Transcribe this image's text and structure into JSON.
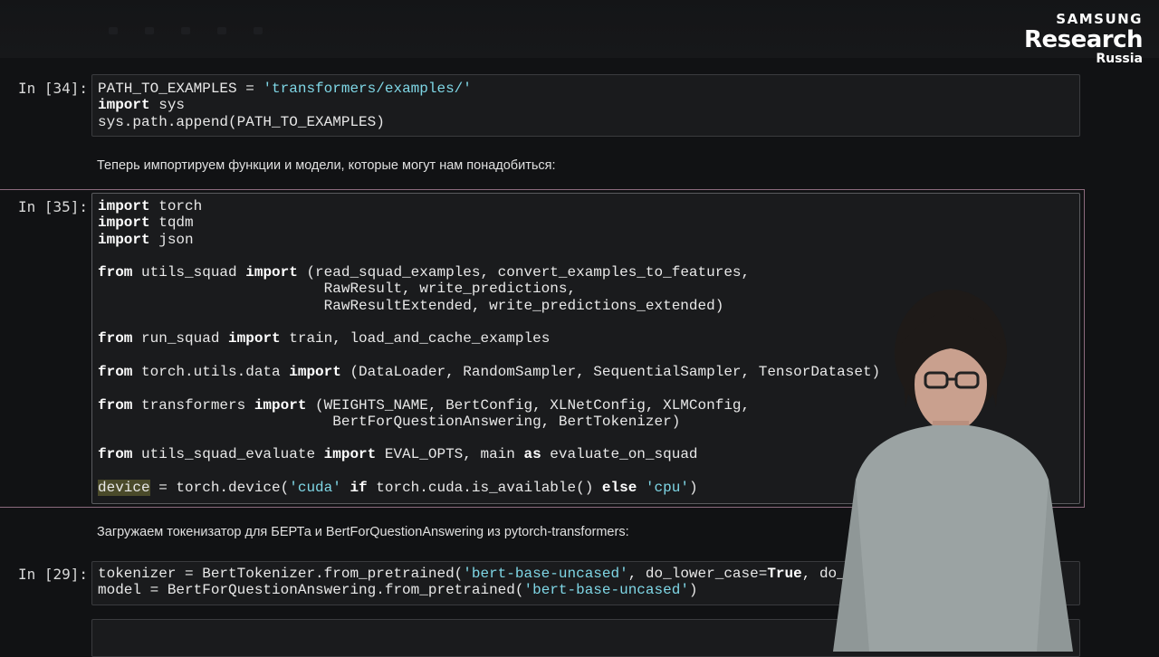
{
  "logo": {
    "line1": "SAMSUNG",
    "line2": "Research",
    "line3": "Russia"
  },
  "cells": [
    {
      "prompt": "In [34]:",
      "lines": [
        [
          [
            "t",
            "PATH_TO_EXAMPLES = "
          ],
          [
            "s",
            "'transformers/examples/'"
          ]
        ],
        [
          [
            "k",
            "import"
          ],
          [
            "t",
            " sys"
          ]
        ],
        [
          [
            "t",
            "sys.path.append(PATH_TO_EXAMPLES)"
          ]
        ]
      ]
    },
    {
      "prompt": "In [35]:",
      "lines": [
        [
          [
            "k",
            "import"
          ],
          [
            "t",
            " torch"
          ]
        ],
        [
          [
            "k",
            "import"
          ],
          [
            "t",
            " tqdm"
          ]
        ],
        [
          [
            "k",
            "import"
          ],
          [
            "t",
            " json"
          ]
        ],
        [],
        [
          [
            "k",
            "from"
          ],
          [
            "t",
            " utils_squad "
          ],
          [
            "k",
            "import"
          ],
          [
            "t",
            " (read_squad_examples, convert_examples_to_features,"
          ]
        ],
        [
          [
            "t",
            "                          RawResult, write_predictions,"
          ]
        ],
        [
          [
            "t",
            "                          RawResultExtended, write_predictions_extended)"
          ]
        ],
        [],
        [
          [
            "k",
            "from"
          ],
          [
            "t",
            " run_squad "
          ],
          [
            "k",
            "import"
          ],
          [
            "t",
            " train, load_and_cache_examples"
          ]
        ],
        [],
        [
          [
            "k",
            "from"
          ],
          [
            "t",
            " torch.utils.data "
          ],
          [
            "k",
            "import"
          ],
          [
            "t",
            " (DataLoader, RandomSampler, SequentialSampler, TensorDataset)"
          ]
        ],
        [],
        [
          [
            "k",
            "from"
          ],
          [
            "t",
            " transformers "
          ],
          [
            "k",
            "import"
          ],
          [
            "t",
            " (WEIGHTS_NAME, BertConfig, XLNetConfig, XLMConfig,"
          ]
        ],
        [
          [
            "t",
            "                           BertForQuestionAnswering, BertTokenizer)"
          ]
        ],
        [],
        [
          [
            "k",
            "from"
          ],
          [
            "t",
            " utils_squad_evaluate "
          ],
          [
            "k",
            "import"
          ],
          [
            "t",
            " EVAL_OPTS, main "
          ],
          [
            "k",
            "as"
          ],
          [
            "t",
            " evaluate_on_squad"
          ]
        ],
        [],
        [
          [
            "h",
            "device"
          ],
          [
            "t",
            " = torch.device("
          ],
          [
            "s",
            "'cuda'"
          ],
          [
            "t",
            " "
          ],
          [
            "k",
            "if"
          ],
          [
            "t",
            " torch.cuda.is_available() "
          ],
          [
            "k",
            "else"
          ],
          [
            "t",
            " "
          ],
          [
            "s",
            "'cpu'"
          ],
          [
            "t",
            ")"
          ]
        ]
      ]
    },
    {
      "prompt": "In [29]:",
      "lines": [
        [
          [
            "t",
            "tokenizer = BertTokenizer.from_pretrained("
          ],
          [
            "s",
            "'bert-base-uncased'"
          ],
          [
            "t",
            ", do_lower_case="
          ],
          [
            "k",
            "True"
          ],
          [
            "t",
            ", do_bas"
          ]
        ],
        [
          [
            "t",
            "model = BertForQuestionAnswering.from_pretrained("
          ],
          [
            "s",
            "'bert-base-uncased'"
          ],
          [
            "t",
            ")"
          ]
        ]
      ]
    }
  ],
  "markdown": [
    "Теперь импортируем функции и модели, которые могут нам понадобиться:",
    "Загружаем токенизатор для БЕРТа и BertForQuestionAnswering из pytorch-transformers:"
  ]
}
